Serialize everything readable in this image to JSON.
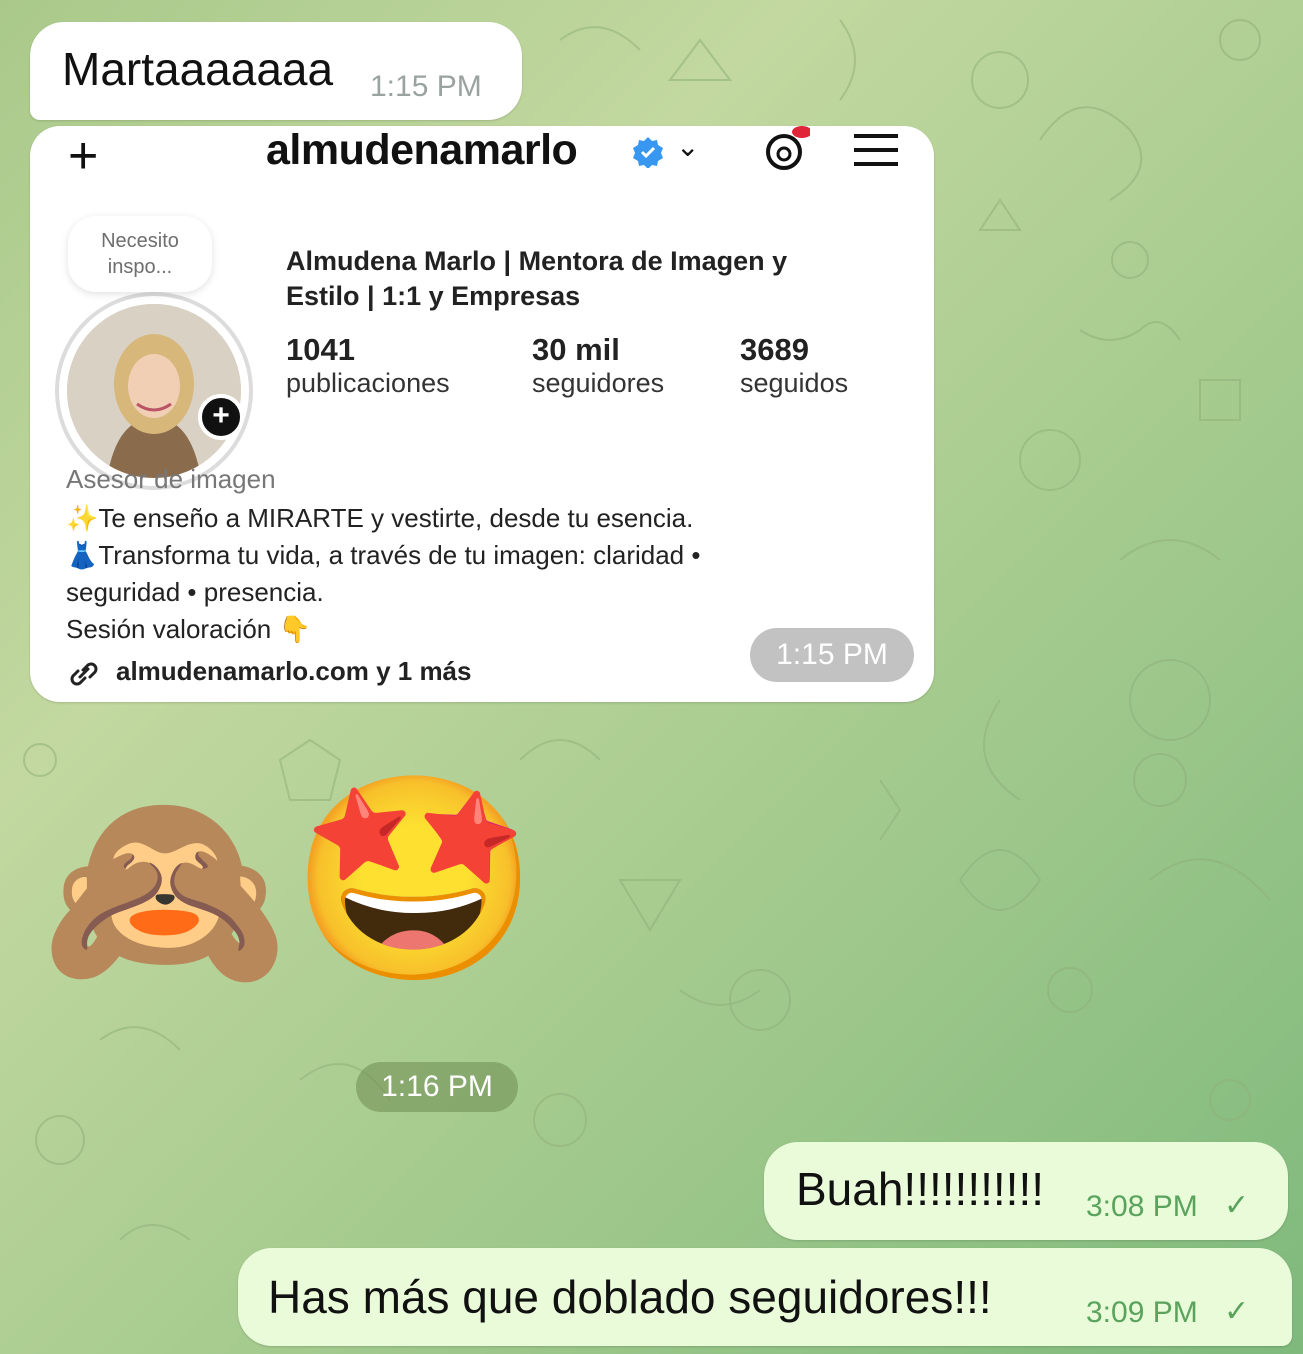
{
  "messages": [
    {
      "direction": "in",
      "text": "Martaaaaaaa",
      "time": "1:15 PM"
    },
    {
      "direction": "in",
      "type": "image",
      "time": "1:15 PM"
    },
    {
      "direction": "in",
      "type": "emoji",
      "emojis": [
        "🙈",
        "🤩"
      ]
    },
    {
      "direction": "out",
      "text": "Buah!!!!!!!!!!!",
      "time": "3:08 PM",
      "status": "✓"
    },
    {
      "direction": "out",
      "text": "Has más que doblado seguidores!!!",
      "time": "3:09 PM",
      "status": "✓"
    }
  ],
  "date_pill": "1:16 PM",
  "instagram": {
    "plus": "+",
    "username": "almudenamarlo",
    "chevron": "⌄",
    "note_text": "Necesito inspo...",
    "avatar_add": "+",
    "full_name": "Almudena Marlo | Mentora de Imagen y Estilo | 1:1 y Empresas",
    "stats": [
      {
        "value": "1041",
        "label": "publicaciones"
      },
      {
        "value": "30 mil",
        "label": "seguidores"
      },
      {
        "value": "3689",
        "label": "seguidos"
      }
    ],
    "category": "Asesor de imagen",
    "bio_lines": [
      "✨Te enseño a MIRARTE y vestirte, desde tu esencia.",
      "👗Transforma tu vida, a través de tu imagen: claridad •",
      "seguridad • presencia.",
      "Sesión valoración 👇"
    ],
    "link": "almudenamarlo.com y 1 más"
  },
  "colors": {
    "outgoing_bubble": "#e9fbd9",
    "outgoing_time": "#5aa35d",
    "verified_blue": "#3897f0"
  }
}
